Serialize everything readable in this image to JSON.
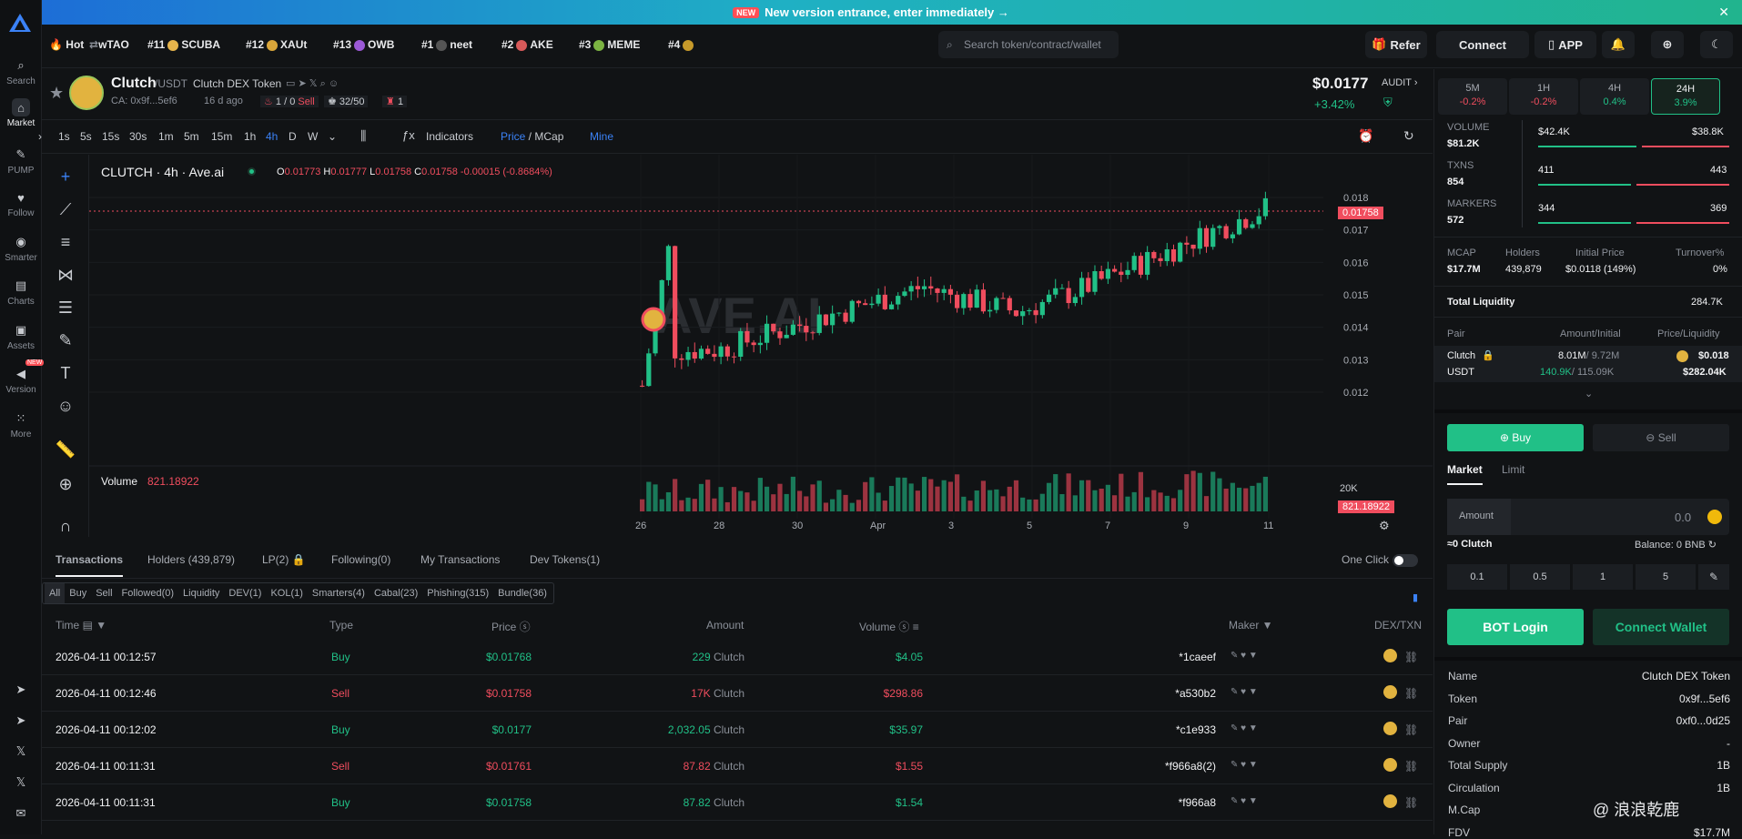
{
  "banner": {
    "badge": "NEW",
    "text": "New version entrance, enter immediately →",
    "close": "✕"
  },
  "sidebar": [
    {
      "label": "Search",
      "icon": "search-icon"
    },
    {
      "label": "Market",
      "icon": "home-icon"
    },
    {
      "label": "PUMP",
      "icon": "pill-icon"
    },
    {
      "label": "Follow",
      "icon": "heart-icon"
    },
    {
      "label": "Smarter",
      "icon": "compass-icon"
    },
    {
      "label": "Charts",
      "icon": "chart-icon"
    },
    {
      "label": "Assets",
      "icon": "wallet-icon"
    },
    {
      "label": "Version",
      "icon": "back-icon",
      "badge": "NEW"
    },
    {
      "label": "More",
      "icon": "grid-icon"
    }
  ],
  "hot": [
    {
      "rank": "",
      "name": "Hot"
    },
    {
      "rank": "",
      "name": "wTAO"
    },
    {
      "rank": "#11",
      "name": "SCUBA"
    },
    {
      "rank": "#12",
      "name": "XAUt"
    },
    {
      "rank": "#13",
      "name": "OWB"
    },
    {
      "rank": "#1",
      "name": "neet"
    },
    {
      "rank": "#2",
      "name": "AKE"
    },
    {
      "rank": "#3",
      "name": "MEME"
    },
    {
      "rank": "#4",
      "name": ""
    }
  ],
  "search": {
    "placeholder": "Search token/contract/wallet"
  },
  "top": {
    "refer": "Refer",
    "connect": "Connect",
    "app": "APP"
  },
  "token": {
    "symbol": "Clutch",
    "pair": "/USDT",
    "fullname": "Clutch DEX Token",
    "ca": "CA: 0x9f...5ef6",
    "age": "16 d ago",
    "buysell": "1 / 0",
    "sell": "Sell",
    "holders_ratio": "32/50",
    "flag": "1",
    "price": "$0.0177",
    "change": "+3.42%",
    "audit": "AUDIT"
  },
  "toolbar": {
    "intervals": [
      "1s",
      "5s",
      "15s",
      "30s",
      "1m",
      "5m",
      "15m",
      "1h",
      "4h",
      "D",
      "W"
    ],
    "active": "4h",
    "indicators": "Indicators",
    "price": "Price",
    "mcap": "MCap",
    "mine": "Mine"
  },
  "chart_title": "CLUTCH · 4h · Ave.ai",
  "ohlc": {
    "o": "0.01773",
    "h": "0.01777",
    "l": "0.01758",
    "c": "0.01758",
    "chg": "-0.00015 (-0.8684%)"
  },
  "volume": {
    "label": "Volume",
    "value": "821.18922",
    "tag": "821.18922",
    "tick": "20K"
  },
  "watermark": "AVE.AI",
  "price_tag": "0.01758",
  "chart_data": {
    "type": "candlestick",
    "y_ticks": [
      "0.018",
      "0.017",
      "0.016",
      "0.015",
      "0.014",
      "0.013",
      "0.012"
    ],
    "ylim": [
      0.0115,
      0.0185
    ],
    "x_ticks": [
      "26",
      "28",
      "30",
      "Apr",
      "3",
      "5",
      "7",
      "9",
      "11"
    ],
    "last_price": 0.01758
  },
  "tabs": [
    {
      "label": "Transactions",
      "active": true
    },
    {
      "label": "Holders (439,879)"
    },
    {
      "label": "LP(2)"
    },
    {
      "label": "Following(0)"
    },
    {
      "label": "My Transactions"
    },
    {
      "label": "Dev Tokens(1)"
    }
  ],
  "one_click": "One Click",
  "filters": [
    "All",
    "Buy",
    "Sell",
    "Followed(0)",
    "Liquidity",
    "DEV(1)",
    "KOL(1)",
    "Smarters(4)",
    "Cabal(23)",
    "Phishing(315)",
    "Bundle(36)"
  ],
  "tx_header": {
    "time": "Time",
    "type": "Type",
    "price": "Price",
    "amount": "Amount",
    "volume": "Volume",
    "maker": "Maker",
    "dex": "DEX/TXN"
  },
  "transactions": [
    {
      "time": "2026-04-11 00:12:57",
      "type": "Buy",
      "price": "$0.01768",
      "amount": "229",
      "unit": "Clutch",
      "volume": "$4.05",
      "maker": "*1caeef"
    },
    {
      "time": "2026-04-11 00:12:46",
      "type": "Sell",
      "price": "$0.01758",
      "amount": "17K",
      "unit": "Clutch",
      "volume": "$298.86",
      "maker": "*a530b2"
    },
    {
      "time": "2026-04-11 00:12:02",
      "type": "Buy",
      "price": "$0.0177",
      "amount": "2,032.05",
      "unit": "Clutch",
      "volume": "$35.97",
      "maker": "*c1e933"
    },
    {
      "time": "2026-04-11 00:11:31",
      "type": "Sell",
      "price": "$0.01761",
      "amount": "87.82",
      "unit": "Clutch",
      "volume": "$1.55",
      "maker": "*f966a8(2)"
    },
    {
      "time": "2026-04-11 00:11:31",
      "type": "Buy",
      "price": "$0.01758",
      "amount": "87.82",
      "unit": "Clutch",
      "volume": "$1.54",
      "maker": "*f966a8"
    }
  ],
  "periods": [
    {
      "label": "5M",
      "change": "-0.2%"
    },
    {
      "label": "1H",
      "change": "-0.2%"
    },
    {
      "label": "4H",
      "change": "0.4%"
    },
    {
      "label": "24H",
      "change": "3.9%"
    }
  ],
  "stats": {
    "volume_label": "VOLUME",
    "volume": "$81.2K",
    "vol_buy": "$42.4K",
    "vol_sell": "$38.8K",
    "txns_label": "TXNS",
    "txns": "854",
    "tx_buy": "411",
    "tx_sell": "443",
    "makers_label": "MARKERS",
    "makers": "572",
    "mk_buy": "344",
    "mk_sell": "369"
  },
  "metrics": {
    "mcap_label": "MCAP",
    "mcap": "$17.7M",
    "holders_label": "Holders",
    "holders": "439,879",
    "init_label": "Initial Price",
    "init": "$0.0118 (149%)",
    "turn_label": "Turnover%",
    "turn": "0%"
  },
  "liquidity": {
    "label": "Total Liquidity",
    "value": "284.7K",
    "pair_h": "Pair",
    "amt_h": "Amount/Initial",
    "pl_h": "Price/Liquidity",
    "t1": "Clutch",
    "t1_amt": "8.01M",
    "t1_init": "/ 9.72M",
    "t1_price": "$0.018",
    "t2": "USDT",
    "t2_amt": "140.9K",
    "t2_init": "/ 115.09K",
    "t2_liq": "$282.04K"
  },
  "trade": {
    "buy": "Buy",
    "sell": "Sell",
    "market": "Market",
    "limit": "Limit",
    "amount_label": "Amount",
    "amount_value": "0.0",
    "receive": "≈0 Clutch",
    "balance": "Balance: 0 BNB",
    "quick": [
      "0.1",
      "0.5",
      "1",
      "5"
    ],
    "bot_login": "BOT Login",
    "connect_wallet": "Connect Wallet"
  },
  "info": [
    {
      "k": "Name",
      "v": "Clutch DEX Token"
    },
    {
      "k": "Token",
      "v": "0x9f...5ef6"
    },
    {
      "k": "Pair",
      "v": "0xf0...0d25"
    },
    {
      "k": "Owner",
      "v": "-"
    },
    {
      "k": "Total Supply",
      "v": "1B"
    },
    {
      "k": "Circulation",
      "v": "1B"
    },
    {
      "k": "M.Cap",
      "v": ""
    },
    {
      "k": "FDV",
      "v": "$17.7M"
    }
  ],
  "watermark_user": "@ 浪浪乾鹿"
}
